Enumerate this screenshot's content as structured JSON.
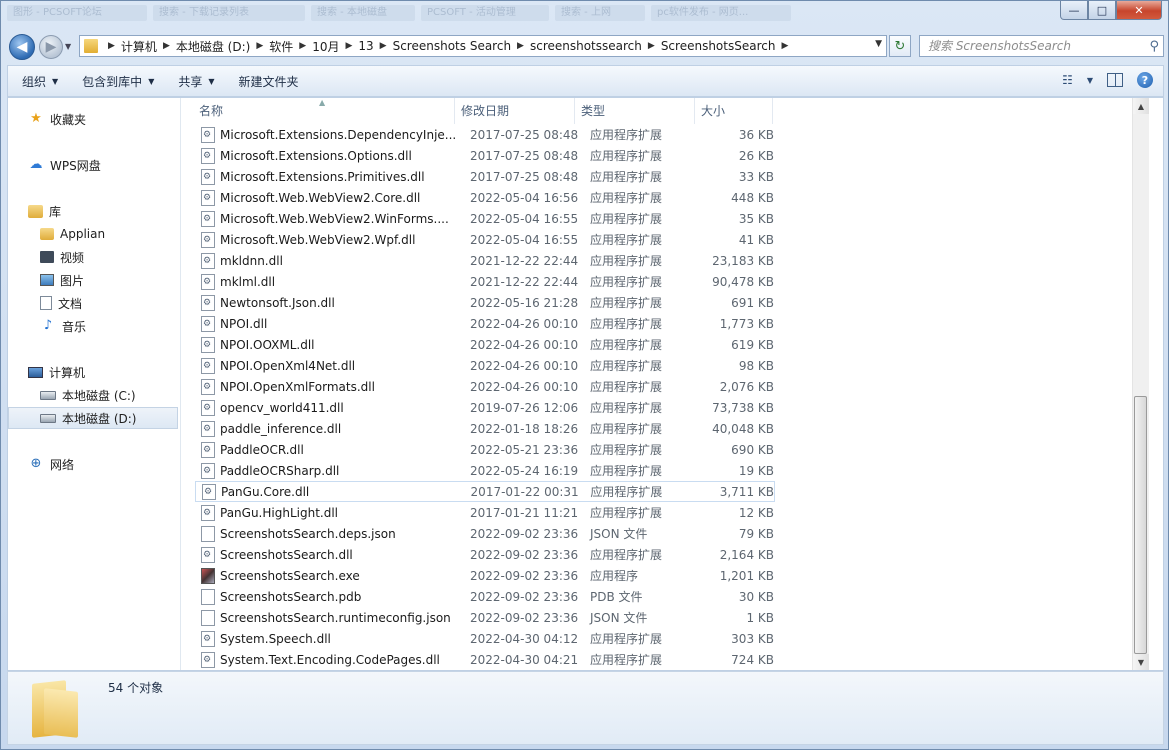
{
  "titlebar": {
    "ghost_tabs": [
      "图形 - PCSOFT论坛",
      "搜索 - 下载记录列表",
      "搜索 - 本地磁盘",
      "PCSOFT - 活动管理",
      "搜索 - 上网",
      "pc软件发布 - 网页..."
    ],
    "controls": {
      "minimize": "—",
      "maximize": "□",
      "close": "✕"
    }
  },
  "address": {
    "back_label": "◀",
    "forward_label": "▶",
    "crumbs": [
      "计算机",
      "本地磁盘 (D:)",
      "软件",
      "10月",
      "13",
      "Screenshots Search",
      "screenshotssearch",
      "ScreenshotsSearch"
    ],
    "search_placeholder": "搜索 ScreenshotsSearch"
  },
  "toolbar": {
    "organize": "组织",
    "include_library": "包含到库中",
    "share": "共享",
    "new_folder": "新建文件夹",
    "view_icon": "☷",
    "help": "?"
  },
  "nav": {
    "favorites": "收藏夹",
    "wps": "WPS网盘",
    "library": "库",
    "lib_items": [
      "Applian",
      "视频",
      "图片",
      "文档",
      "音乐"
    ],
    "computer": "计算机",
    "drives": [
      "本地磁盘 (C:)",
      "本地磁盘 (D:)"
    ],
    "network": "网络"
  },
  "columns": {
    "name": "名称",
    "date": "修改日期",
    "type": "类型",
    "size": "大小"
  },
  "files": [
    {
      "name": "Microsoft.Extensions.DependencyInje...",
      "date": "2017-07-25 08:48",
      "type": "应用程序扩展",
      "size": "36 KB",
      "icon": "gear"
    },
    {
      "name": "Microsoft.Extensions.Options.dll",
      "date": "2017-07-25 08:48",
      "type": "应用程序扩展",
      "size": "26 KB",
      "icon": "gear"
    },
    {
      "name": "Microsoft.Extensions.Primitives.dll",
      "date": "2017-07-25 08:48",
      "type": "应用程序扩展",
      "size": "33 KB",
      "icon": "gear"
    },
    {
      "name": "Microsoft.Web.WebView2.Core.dll",
      "date": "2022-05-04 16:56",
      "type": "应用程序扩展",
      "size": "448 KB",
      "icon": "gear"
    },
    {
      "name": "Microsoft.Web.WebView2.WinForms....",
      "date": "2022-05-04 16:55",
      "type": "应用程序扩展",
      "size": "35 KB",
      "icon": "gear"
    },
    {
      "name": "Microsoft.Web.WebView2.Wpf.dll",
      "date": "2022-05-04 16:55",
      "type": "应用程序扩展",
      "size": "41 KB",
      "icon": "gear"
    },
    {
      "name": "mkldnn.dll",
      "date": "2021-12-22 22:44",
      "type": "应用程序扩展",
      "size": "23,183 KB",
      "icon": "gear"
    },
    {
      "name": "mklml.dll",
      "date": "2021-12-22 22:44",
      "type": "应用程序扩展",
      "size": "90,478 KB",
      "icon": "gear"
    },
    {
      "name": "Newtonsoft.Json.dll",
      "date": "2022-05-16 21:28",
      "type": "应用程序扩展",
      "size": "691 KB",
      "icon": "gear"
    },
    {
      "name": "NPOI.dll",
      "date": "2022-04-26 00:10",
      "type": "应用程序扩展",
      "size": "1,773 KB",
      "icon": "gear"
    },
    {
      "name": "NPOI.OOXML.dll",
      "date": "2022-04-26 00:10",
      "type": "应用程序扩展",
      "size": "619 KB",
      "icon": "gear"
    },
    {
      "name": "NPOI.OpenXml4Net.dll",
      "date": "2022-04-26 00:10",
      "type": "应用程序扩展",
      "size": "98 KB",
      "icon": "gear"
    },
    {
      "name": "NPOI.OpenXmlFormats.dll",
      "date": "2022-04-26 00:10",
      "type": "应用程序扩展",
      "size": "2,076 KB",
      "icon": "gear"
    },
    {
      "name": "opencv_world411.dll",
      "date": "2019-07-26 12:06",
      "type": "应用程序扩展",
      "size": "73,738 KB",
      "icon": "gear"
    },
    {
      "name": "paddle_inference.dll",
      "date": "2022-01-18 18:26",
      "type": "应用程序扩展",
      "size": "40,048 KB",
      "icon": "gear"
    },
    {
      "name": "PaddleOCR.dll",
      "date": "2022-05-21 23:36",
      "type": "应用程序扩展",
      "size": "690 KB",
      "icon": "gear"
    },
    {
      "name": "PaddleOCRSharp.dll",
      "date": "2022-05-24 16:19",
      "type": "应用程序扩展",
      "size": "19 KB",
      "icon": "gear"
    },
    {
      "name": "PanGu.Core.dll",
      "date": "2017-01-22 00:31",
      "type": "应用程序扩展",
      "size": "3,711 KB",
      "icon": "gear"
    },
    {
      "name": "PanGu.HighLight.dll",
      "date": "2017-01-21 11:21",
      "type": "应用程序扩展",
      "size": "12 KB",
      "icon": "gear"
    },
    {
      "name": "ScreenshotsSearch.deps.json",
      "date": "2022-09-02 23:36",
      "type": "JSON 文件",
      "size": "79 KB",
      "icon": "blank"
    },
    {
      "name": "ScreenshotsSearch.dll",
      "date": "2022-09-02 23:36",
      "type": "应用程序扩展",
      "size": "2,164 KB",
      "icon": "gear"
    },
    {
      "name": "ScreenshotsSearch.exe",
      "date": "2022-09-02 23:36",
      "type": "应用程序",
      "size": "1,201 KB",
      "icon": "exe"
    },
    {
      "name": "ScreenshotsSearch.pdb",
      "date": "2022-09-02 23:36",
      "type": "PDB 文件",
      "size": "30 KB",
      "icon": "blank"
    },
    {
      "name": "ScreenshotsSearch.runtimeconfig.json",
      "date": "2022-09-02 23:36",
      "type": "JSON 文件",
      "size": "1 KB",
      "icon": "blank"
    },
    {
      "name": "System.Speech.dll",
      "date": "2022-04-30 04:12",
      "type": "应用程序扩展",
      "size": "303 KB",
      "icon": "gear"
    },
    {
      "name": "System.Text.Encoding.CodePages.dll",
      "date": "2022-04-30 04:21",
      "type": "应用程序扩展",
      "size": "724 KB",
      "icon": "gear"
    }
  ],
  "hovered_file": "PanGu.Core.dll",
  "status": {
    "count": "54 个对象"
  }
}
